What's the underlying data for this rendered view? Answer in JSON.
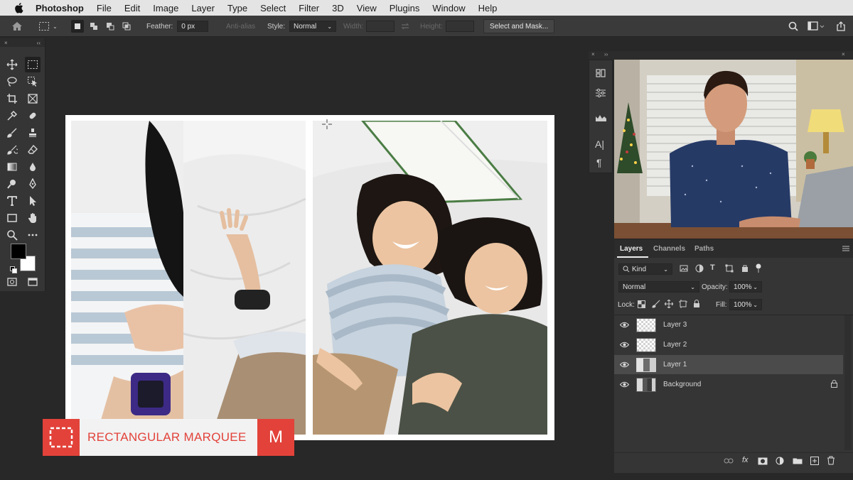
{
  "menubar": {
    "apple_icon": "apple-logo-icon",
    "app_name": "Photoshop",
    "items": [
      "File",
      "Edit",
      "Image",
      "Layer",
      "Type",
      "Select",
      "Filter",
      "3D",
      "View",
      "Plugins",
      "Window",
      "Help"
    ]
  },
  "options_bar": {
    "feather_label": "Feather:",
    "feather_value": "0 px",
    "antialias_label": "Anti-alias",
    "style_label": "Style:",
    "style_value": "Normal",
    "width_label": "Width:",
    "height_label": "Height:",
    "select_mask_label": "Select and Mask..."
  },
  "tools_panel": {
    "tools": [
      "move-tool",
      "rectangular-marquee-tool",
      "lasso-tool",
      "object-selection-tool",
      "crop-tool",
      "frame-tool",
      "eyedropper-tool",
      "spot-healing-tool",
      "brush-tool",
      "clone-stamp-tool",
      "history-brush-tool",
      "eraser-tool",
      "gradient-tool",
      "blur-tool",
      "dodge-tool",
      "pen-tool",
      "type-tool",
      "path-selection-tool",
      "rectangle-tool",
      "hand-tool",
      "zoom-tool",
      "more-tools"
    ],
    "foreground_color": "#000000",
    "background_color": "#ffffff"
  },
  "lower_third": {
    "tool_name": "RECTANGULAR MARQUEE",
    "shortcut": "M",
    "accent_color": "#e2423a"
  },
  "layers_panel": {
    "tabs": [
      "Layers",
      "Channels",
      "Paths"
    ],
    "filter_label": "Kind",
    "blend_mode": "Normal",
    "opacity_label": "Opacity:",
    "opacity_value": "100%",
    "lock_label": "Lock:",
    "fill_label": "Fill:",
    "fill_value": "100%",
    "layers": [
      {
        "name": "Layer 3",
        "selected": false,
        "thumbnail": "transparent"
      },
      {
        "name": "Layer 2",
        "selected": false,
        "thumbnail": "transparent"
      },
      {
        "name": "Layer 1",
        "selected": true,
        "thumbnail": "photo"
      },
      {
        "name": "Background",
        "selected": false,
        "thumbnail": "photo",
        "locked": true
      }
    ]
  },
  "colors": {
    "menubar_bg": "#e4e4e4",
    "panel_bg": "#353535",
    "workspace_bg": "#282828",
    "selected_layer_bg": "#4b4b4b"
  }
}
